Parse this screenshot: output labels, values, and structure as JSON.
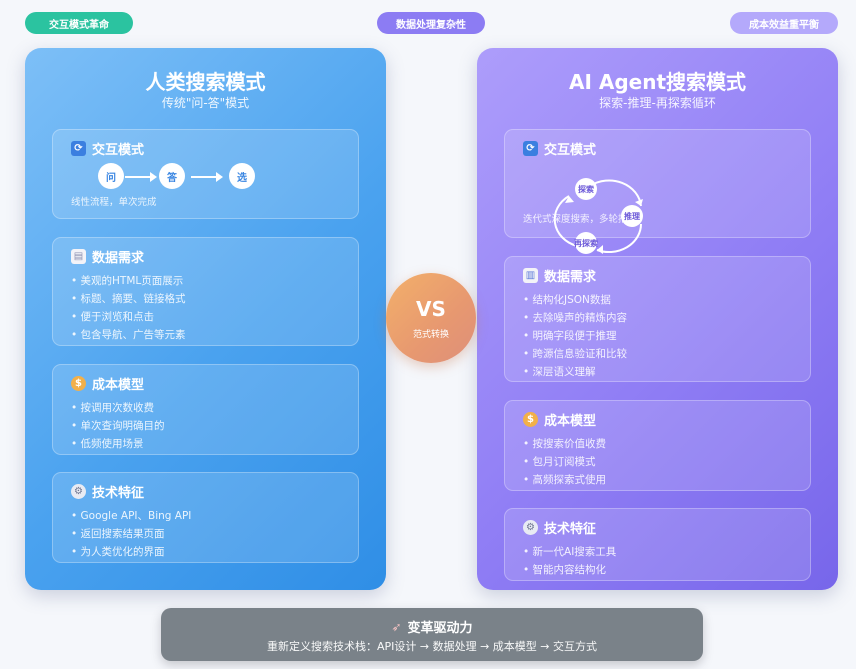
{
  "top_pills": [
    "交互模式革命",
    "数据处理复杂性",
    "成本效益重平衡"
  ],
  "left": {
    "title": "人类搜索模式",
    "subtitle": "传统\"问-答\"模式",
    "interaction": {
      "title": "交互模式",
      "nodes": [
        "问",
        "答",
        "选"
      ],
      "note": "线性流程，单次完成"
    },
    "data": {
      "title": "数据需求",
      "items": [
        "美观的HTML页面展示",
        "标题、摘要、链接格式",
        "便于浏览和点击",
        "包含导航、广告等元素"
      ]
    },
    "cost": {
      "title": "成本模型",
      "items": [
        "按调用次数收费",
        "单次查询明确目的",
        "低频使用场景"
      ]
    },
    "tech": {
      "title": "技术特征",
      "items": [
        "Google API、Bing API",
        "返回搜索结果页面",
        "为人类优化的界面"
      ]
    }
  },
  "right": {
    "title": "AI Agent搜索模式",
    "subtitle": "探索-推理-再探索循环",
    "interaction": {
      "title": "交互模式",
      "nodes": [
        "探索",
        "推理",
        "再探索"
      ],
      "note": "迭代式深度搜索，多轮推理"
    },
    "data": {
      "title": "数据需求",
      "items": [
        "结构化JSON数据",
        "去除噪声的精炼内容",
        "明确字段便于推理",
        "跨源信息验证和比较",
        "深层语义理解"
      ]
    },
    "cost": {
      "title": "成本模型",
      "items": [
        "按搜索价值收费",
        "包月订阅模式",
        "高频探索式使用"
      ]
    },
    "tech": {
      "title": "技术特征",
      "items": [
        "新一代AI搜索工具",
        "智能内容结构化"
      ]
    }
  },
  "vs": {
    "label": "VS",
    "sub": "范式转换"
  },
  "bottom": {
    "title": "变革驱动力",
    "subtitle": "重新定义搜索技术栈：API设计 → 数据处理 → 成本模型 → 交互方式"
  },
  "icons": {
    "interaction": "cycle-icon",
    "data": "document-icon",
    "data_right": "bar-chart-icon",
    "cost": "money-bag-icon",
    "tech": "gear-icon",
    "bottom": "rocket-icon"
  },
  "colors": {
    "left_panel": "#4aa2ef",
    "right_panel": "#907ef5",
    "vs": "#e79870",
    "bottom_bar": "#7a8289"
  }
}
